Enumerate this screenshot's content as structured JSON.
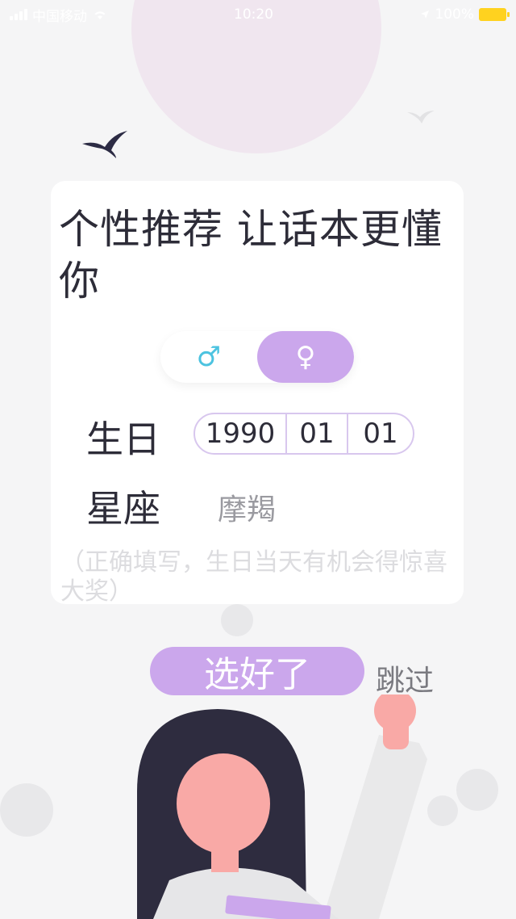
{
  "status_bar": {
    "carrier": "中国移动",
    "time": "10:20",
    "battery": "100%"
  },
  "card": {
    "title": "个性推荐 让话本更懂你",
    "gender": {
      "male_symbol": "♂",
      "female_symbol": "♀",
      "selected": "female"
    },
    "birthday": {
      "label": "生日",
      "year": "1990",
      "month": "01",
      "day": "01"
    },
    "zodiac": {
      "label": "星座",
      "value": "摩羯"
    },
    "hint": "（正确填写，生日当天有机会得惊喜大奖）"
  },
  "actions": {
    "confirm_label": "选好了",
    "skip_label": "跳过"
  },
  "colors": {
    "accent": "#cba7ec",
    "male_icon": "#4cc3e0",
    "battery": "#ffd21f"
  }
}
